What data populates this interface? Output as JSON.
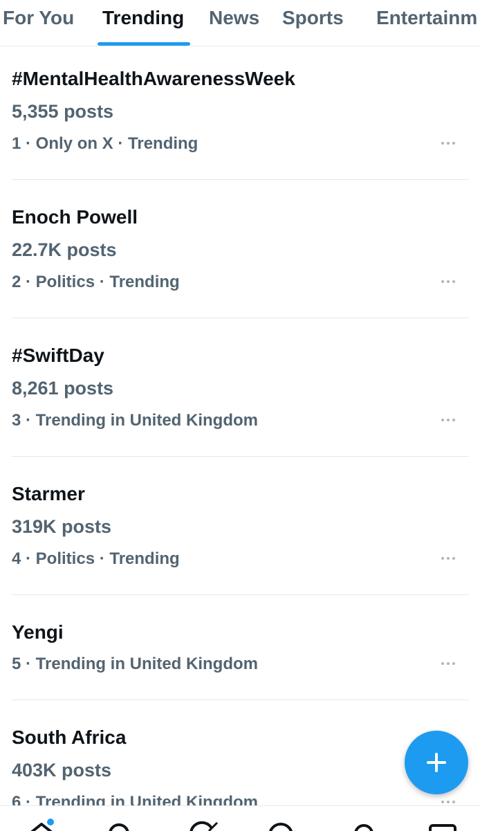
{
  "tabs": [
    {
      "label": "For You"
    },
    {
      "label": "Trending"
    },
    {
      "label": "News"
    },
    {
      "label": "Sports"
    },
    {
      "label": "Entertainm"
    }
  ],
  "active_tab": "Trending",
  "trends": [
    {
      "title": "#MentalHealthAwarenessWeek",
      "posts": "5,355 posts",
      "meta": "1 · Only on X · Trending"
    },
    {
      "title": "Enoch Powell",
      "posts": "22.7K posts",
      "meta": "2 · Politics · Trending"
    },
    {
      "title": "#SwiftDay",
      "posts": "8,261 posts",
      "meta": "3 · Trending in United Kingdom"
    },
    {
      "title": "Starmer",
      "posts": "319K posts",
      "meta": "4 · Politics · Trending"
    },
    {
      "title": "Yengi",
      "posts": "",
      "meta": "5 · Trending in United Kingdom"
    },
    {
      "title": "South Africa",
      "posts": "403K posts",
      "meta": "6 · Trending in United Kingdom"
    }
  ],
  "icons": {
    "more": "more-horizontal-icon",
    "compose": "plus-icon",
    "nav": [
      "home-icon",
      "search-icon",
      "grok-icon",
      "communities-icon",
      "notifications-icon",
      "messages-icon"
    ]
  },
  "colors": {
    "accent": "#1d9bf0",
    "primary_text": "#0f1419",
    "secondary_text": "#536471"
  }
}
